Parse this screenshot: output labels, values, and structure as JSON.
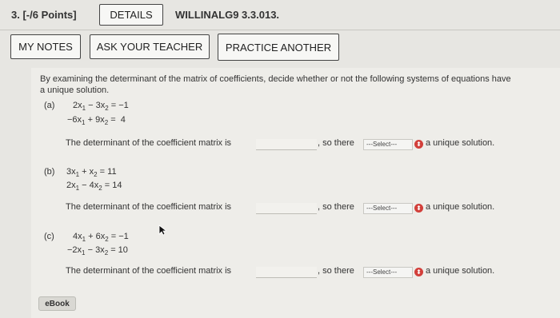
{
  "header": {
    "question_number": "3. [-/6 Points]",
    "details_label": "DETAILS",
    "question_code": "WILLINALG9 3.3.013."
  },
  "toolbar": {
    "my_notes": "MY NOTES",
    "ask_teacher": "ASK YOUR TEACHER",
    "practice_another": "PRACTICE ANOTHER"
  },
  "question": {
    "intro_line1": "By examining the determinant of the matrix of coefficients, decide whether or not the following systems of equations have",
    "intro_line2": "a unique solution."
  },
  "parts": [
    {
      "label": "(a)",
      "eq1": {
        "c1": "2x",
        "op": "−",
        "c2": "3x",
        "rhs": "= −1"
      },
      "eq2": {
        "c1": "−6x",
        "op": "+",
        "c2": "9x",
        "rhs": "=  4"
      },
      "determinant_text": "The determinant of the coefficient matrix is",
      "so_there": ", so there",
      "select_value": "---Select---",
      "unique_text": "a unique solution."
    },
    {
      "label": "(b)",
      "eq1": {
        "c1": "3x",
        "op": "+",
        "c2": "x",
        "rhs": "= 11"
      },
      "eq2": {
        "c1": "2x",
        "op": "−",
        "c2": "4x",
        "rhs": "= 14"
      },
      "determinant_text": "The determinant of the coefficient matrix is",
      "so_there": ", so there",
      "select_value": "---Select---",
      "unique_text": "a unique solution."
    },
    {
      "label": "(c)",
      "eq1": {
        "c1": "4x",
        "op": "+",
        "c2": "6x",
        "rhs": "= −1"
      },
      "eq2": {
        "c1": "−2x",
        "op": "−",
        "c2": "3x",
        "rhs": "= 10"
      },
      "determinant_text": "The determinant of the coefficient matrix is",
      "so_there": ", so there",
      "select_value": "---Select---",
      "unique_text": "a unique solution."
    }
  ],
  "subscripts": {
    "s1": "1",
    "s2": "2"
  },
  "select_icon": "chevron-updown-icon",
  "ebook_label": "eBook"
}
